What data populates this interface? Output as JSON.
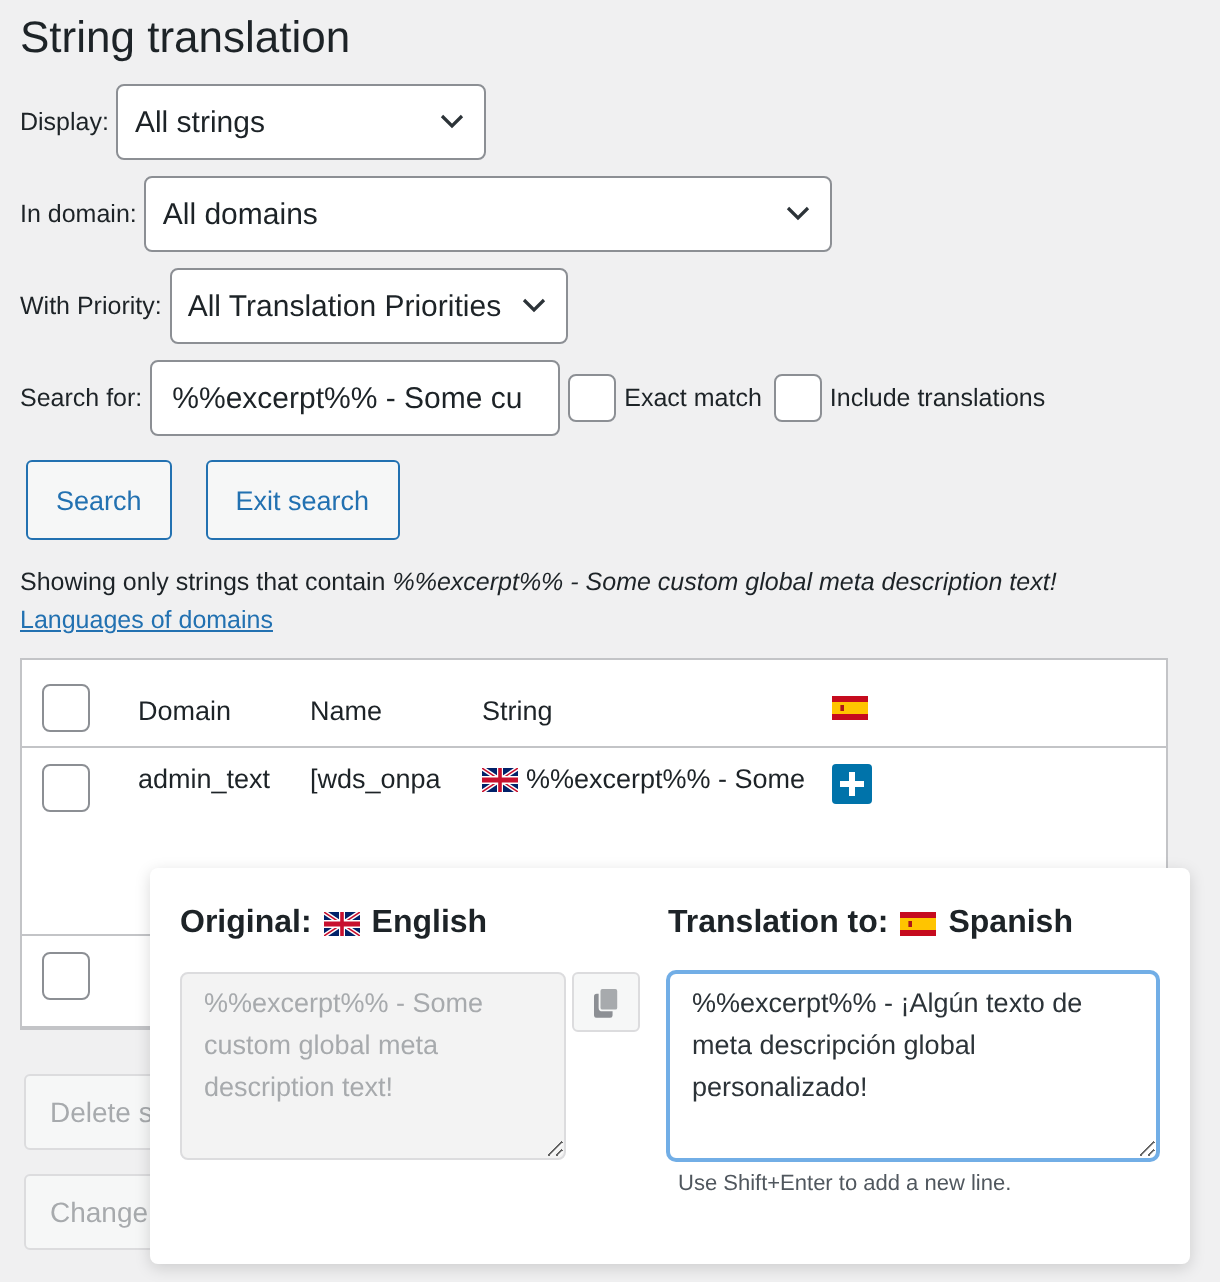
{
  "title": "String translation",
  "filters": [
    {
      "label": "Display:",
      "value": "All strings"
    },
    {
      "label": "In domain:",
      "value": "All domains"
    },
    {
      "label": "With Priority:",
      "value": "All Translation Priorities"
    }
  ],
  "search": {
    "label": "Search for:",
    "value": "%%excerpt%% - Some cu",
    "options": [
      {
        "label": "Exact match",
        "checked": false
      },
      {
        "label": "Include translations",
        "checked": false
      }
    ]
  },
  "buttons": [
    "Search",
    "Exit search"
  ],
  "notice": "Showing only strings that contain *%%excerpt%% - Some custom global meta description text!*",
  "link": "Languages of domains",
  "table": {
    "select_all_checked": false,
    "columns": [
      "Domain",
      "Name",
      "String"
    ],
    "rows": [
      {
        "checked": false,
        "domain": "admin_text",
        "name": "[wds_onpa",
        "string": "%%excerpt%% - Some"
      },
      {
        "checked": false
      }
    ]
  },
  "bulk_buttons": [
    "Delete s",
    "Change"
  ],
  "popup": {
    "original_label": "Original:",
    "original_language": "English",
    "translation_label": "Translation to:",
    "translation_language": "Spanish",
    "original_text": "%%excerpt%% - Some custom global meta description text!",
    "translation_text": "%%excerpt%% - ¡Algún texto de meta descripción global personalizado!",
    "hint": "Use Shift+Enter to add a new line."
  }
}
